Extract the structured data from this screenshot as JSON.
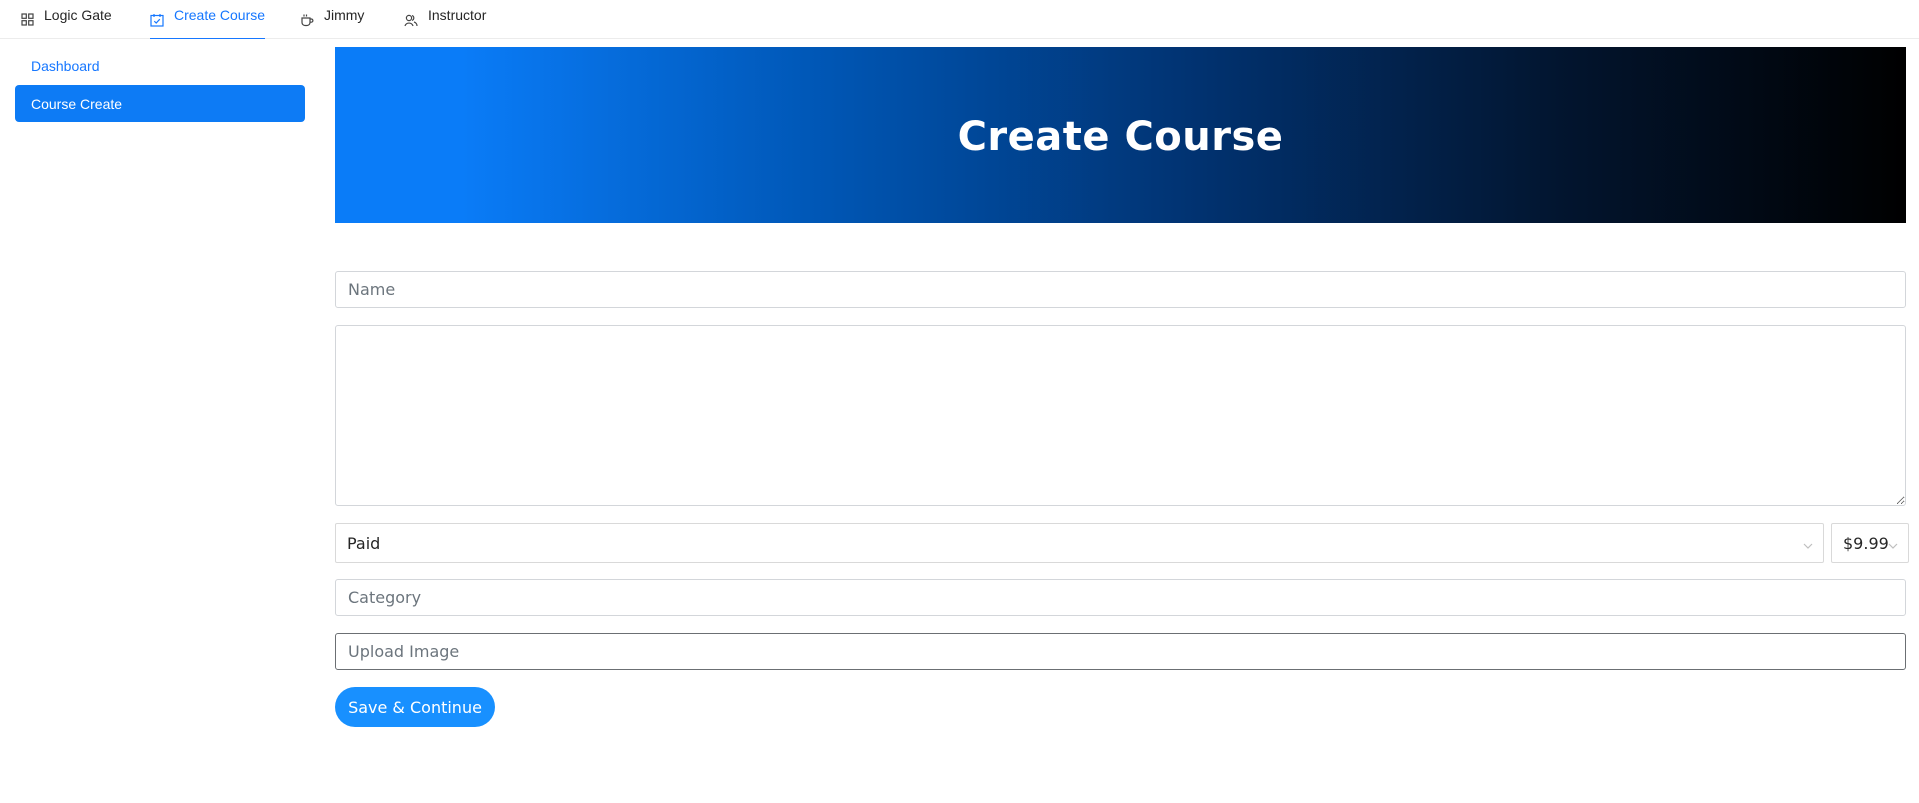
{
  "topnav": {
    "items": [
      {
        "label": "Logic Gate",
        "icon": "appstore-icon"
      },
      {
        "label": "Create Course",
        "icon": "calendar-check-icon",
        "active": true
      },
      {
        "label": "Jimmy",
        "icon": "coffee-cup-icon"
      },
      {
        "label": "Instructor",
        "icon": "team-icon"
      }
    ]
  },
  "sidebar": {
    "items": [
      {
        "label": "Dashboard"
      },
      {
        "label": "Course Create",
        "selected": true
      }
    ]
  },
  "hero": {
    "title": "Create Course"
  },
  "form": {
    "name_placeholder": "Name",
    "description_value": "",
    "paid_select_value": "Paid",
    "price_select_value": "$9.99",
    "category_placeholder": "Category",
    "upload_placeholder": "Upload Image",
    "submit_label": "Save & Continue"
  },
  "colors": {
    "accent": "#1677ff",
    "sidebar_selected": "#0d7bf5",
    "button": "#1890ff",
    "hero_gradient_start": "#0a7cf8",
    "hero_gradient_end": "#000000"
  }
}
